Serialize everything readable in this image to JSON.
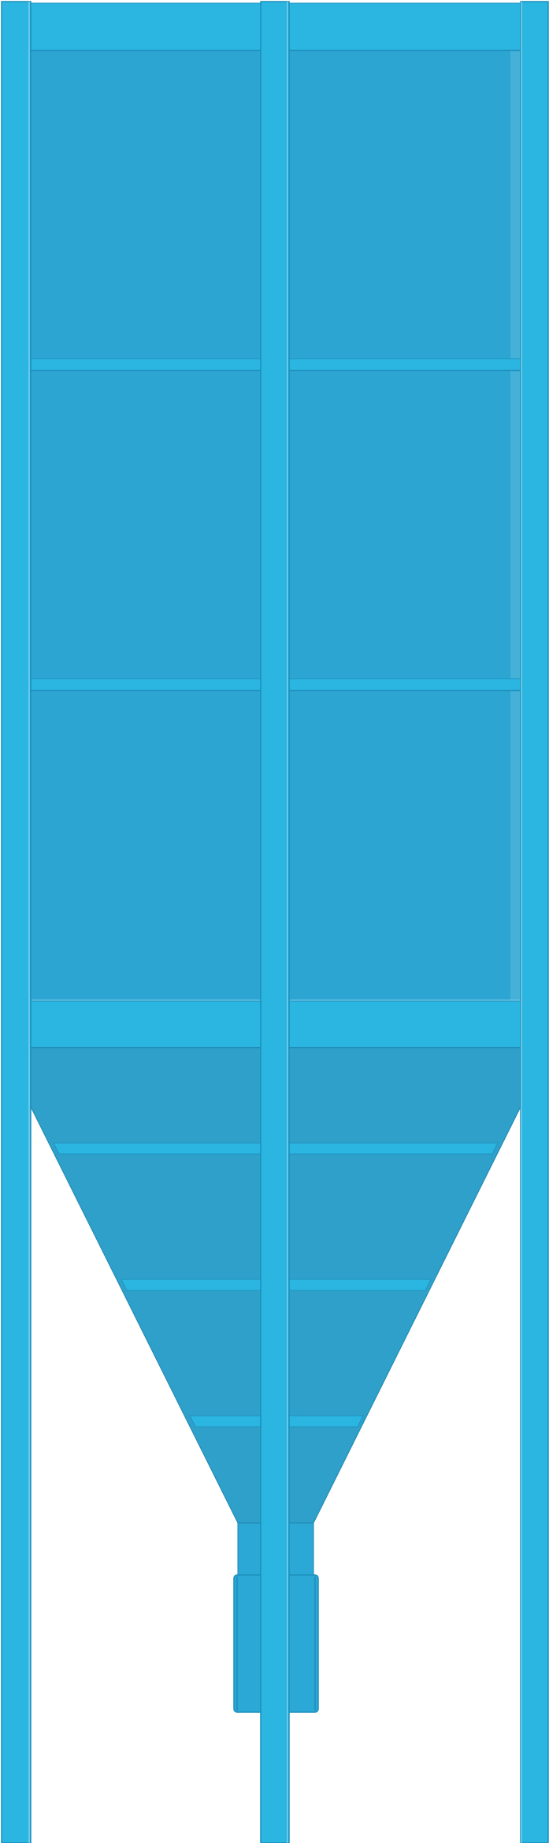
{
  "colors": {
    "leg": "#2bb6e2",
    "leg_edge": "#1b8fba",
    "body": "#2ca5d2",
    "body_edge": "#1d86b0",
    "band": "#2bb6e2",
    "band_dark": "#2193c0",
    "hopper": "#2fa0c9",
    "outlet": "#2ca8d6",
    "highlight": "#8fd6ee",
    "background": "#ffffff"
  }
}
